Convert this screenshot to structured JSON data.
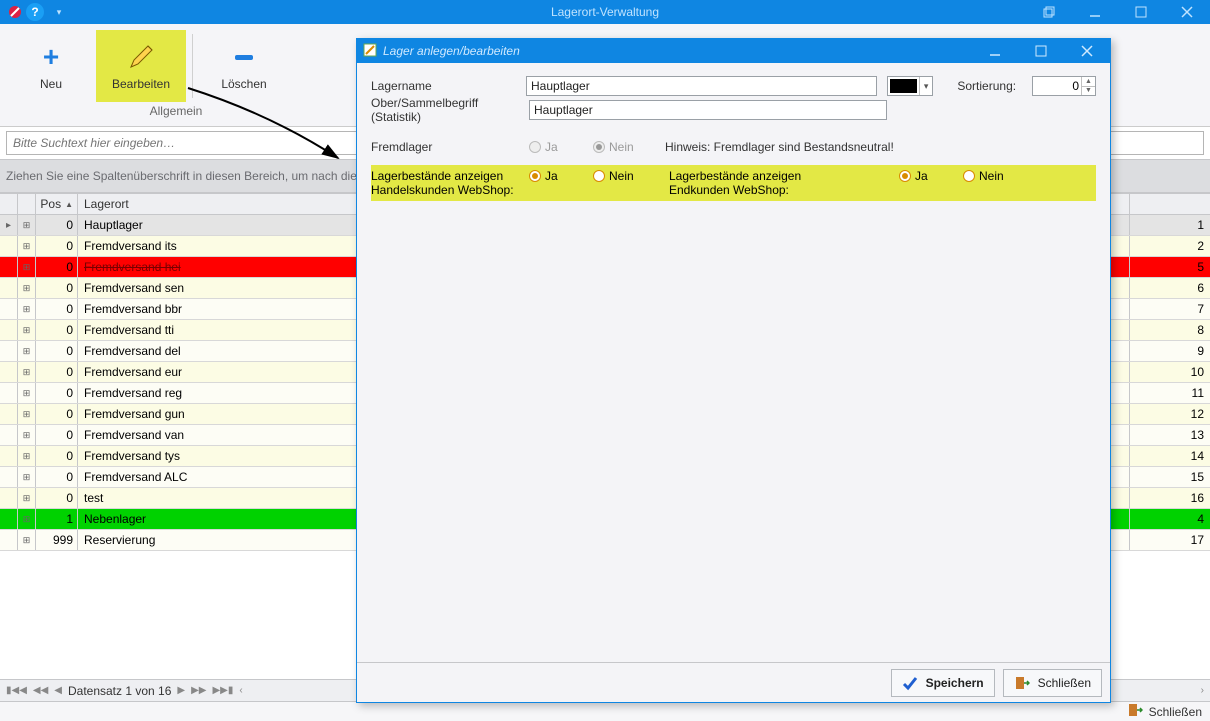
{
  "window": {
    "title": "Lagerort-Verwaltung"
  },
  "ribbon": {
    "group_title": "Allgemein",
    "neu": "Neu",
    "bearbeiten": "Bearbeiten",
    "loeschen": "Löschen"
  },
  "search": {
    "placeholder": "Bitte Suchtext hier eingeben…"
  },
  "groupby": {
    "hint": "Ziehen Sie eine Spaltenüberschrift in diesen Bereich, um nach dieser zu gruppieren"
  },
  "grid": {
    "col_pos": "Pos",
    "col_lagerort": "Lagerort",
    "rows": [
      {
        "pos": "0",
        "name": "Hauptlager",
        "right": "1",
        "style": "sel"
      },
      {
        "pos": "0",
        "name": "Fremdversand its",
        "right": "2",
        "style": "even"
      },
      {
        "pos": "0",
        "name": "Fremdversand hei",
        "right": "5",
        "style": "red"
      },
      {
        "pos": "0",
        "name": "Fremdversand sen",
        "right": "6",
        "style": "even"
      },
      {
        "pos": "0",
        "name": "Fremdversand bbr",
        "right": "7",
        "style": "odd"
      },
      {
        "pos": "0",
        "name": "Fremdversand tti",
        "right": "8",
        "style": "even"
      },
      {
        "pos": "0",
        "name": "Fremdversand del",
        "right": "9",
        "style": "odd"
      },
      {
        "pos": "0",
        "name": "Fremdversand eur",
        "right": "10",
        "style": "even"
      },
      {
        "pos": "0",
        "name": "Fremdversand reg",
        "right": "11",
        "style": "odd"
      },
      {
        "pos": "0",
        "name": "Fremdversand gun",
        "right": "12",
        "style": "even"
      },
      {
        "pos": "0",
        "name": "Fremdversand van",
        "right": "13",
        "style": "odd"
      },
      {
        "pos": "0",
        "name": "Fremdversand tys",
        "right": "14",
        "style": "even"
      },
      {
        "pos": "0",
        "name": "Fremdversand ALC",
        "right": "15",
        "style": "odd"
      },
      {
        "pos": "0",
        "name": "test",
        "right": "16",
        "style": "even"
      },
      {
        "pos": "1",
        "name": "Nebenlager",
        "right": "4",
        "style": "green"
      },
      {
        "pos": "999",
        "name": "Reservierung",
        "right": "17",
        "style": "odd"
      }
    ]
  },
  "paginator": {
    "label": "Datensatz 1 von 16"
  },
  "statusbar": {
    "close": "Schließen"
  },
  "dialog": {
    "title": "Lager anlegen/bearbeiten",
    "lagername_label": "Lagername",
    "lagername_value": "Hauptlager",
    "sammel_label": "Ober/Sammelbegriff (Statistik)",
    "sammel_value": "Hauptlager",
    "sortierung_label": "Sortierung:",
    "sortierung_value": "0",
    "fremdlager_label": "Fremdlager",
    "ja": "Ja",
    "nein": "Nein",
    "fremd_hint": "Hinweis: Fremdlager sind Bestandsneutral!",
    "hk_line1": "Lagerbestände anzeigen",
    "hk_line2": "Handelskunden WebShop:",
    "ek_line1": "Lagerbestände anzeigen",
    "ek_line2": "Endkunden WebShop:",
    "speichern": "Speichern",
    "schliessen": "Schließen",
    "hk_selected": "Ja",
    "ek_selected": "Ja",
    "fremdlager_selected": "Nein",
    "color_swatch": "#000000"
  }
}
